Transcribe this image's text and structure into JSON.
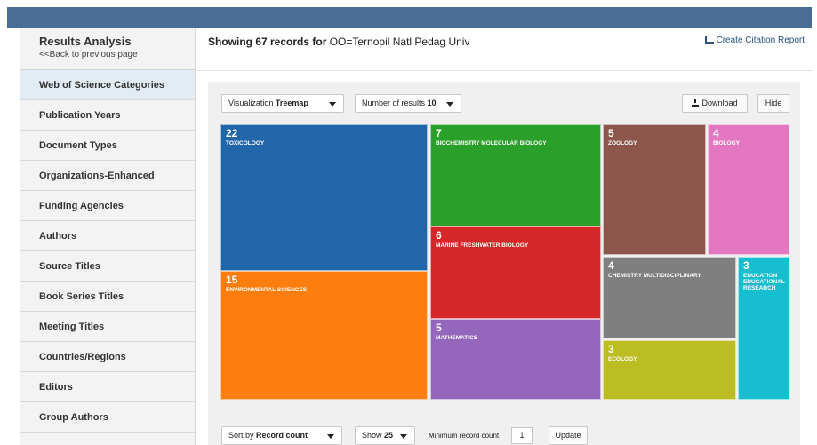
{
  "sidebar": {
    "title": "Results Analysis",
    "back_link": "<<Back to previous page",
    "items": [
      {
        "label": "Web of Science Categories"
      },
      {
        "label": "Publication Years"
      },
      {
        "label": "Document Types"
      },
      {
        "label": "Organizations-Enhanced"
      },
      {
        "label": "Funding Agencies"
      },
      {
        "label": "Authors"
      },
      {
        "label": "Source Titles"
      },
      {
        "label": "Book Series Titles"
      },
      {
        "label": "Meeting Titles"
      },
      {
        "label": "Countries/Regions"
      },
      {
        "label": "Editors"
      },
      {
        "label": "Group Authors"
      }
    ]
  },
  "header": {
    "showing_prefix": "Showing 67 records for",
    "query": "OO=Ternopil Natl Pedag Univ",
    "citation_report": "Create Citation Report"
  },
  "controls": {
    "visualization_label": "Visualization",
    "visualization_value": "Treemap",
    "num_results_label": "Number of results",
    "num_results_value": "10",
    "download": "Download",
    "hide": "Hide"
  },
  "bottom": {
    "sort_label": "Sort by",
    "sort_value": "Record count",
    "show_label": "Show",
    "show_value": "25",
    "min_label": "Minimum record count",
    "min_value": "1",
    "update": "Update"
  },
  "chart_data": {
    "type": "treemap",
    "items": [
      {
        "count": "22",
        "label": "TOXICOLOGY",
        "color": "#2166a8"
      },
      {
        "count": "15",
        "label": "ENVIRONMENTAL SCIENCES",
        "color": "#fd7e0e"
      },
      {
        "count": "7",
        "label": "BIOCHEMISTRY MOLECULAR BIOLOGY",
        "color": "#2aa02b"
      },
      {
        "count": "6",
        "label": "MARINE FRESHWATER BIOLOGY",
        "color": "#d62728"
      },
      {
        "count": "5",
        "label": "MATHEMATICS",
        "color": "#9467bd"
      },
      {
        "count": "5",
        "label": "ZOOLOGY",
        "color": "#8c564b"
      },
      {
        "count": "4",
        "label": "BIOLOGY",
        "color": "#e377c2"
      },
      {
        "count": "4",
        "label": "CHEMISTRY MULTIDISCIPLINARY",
        "color": "#7f7f7f"
      },
      {
        "count": "3",
        "label": "ECOLOGY",
        "color": "#bcbd22"
      },
      {
        "count": "3",
        "label": "EDUCATION EDUCATIONAL RESEARCH",
        "color": "#17becf"
      }
    ]
  }
}
